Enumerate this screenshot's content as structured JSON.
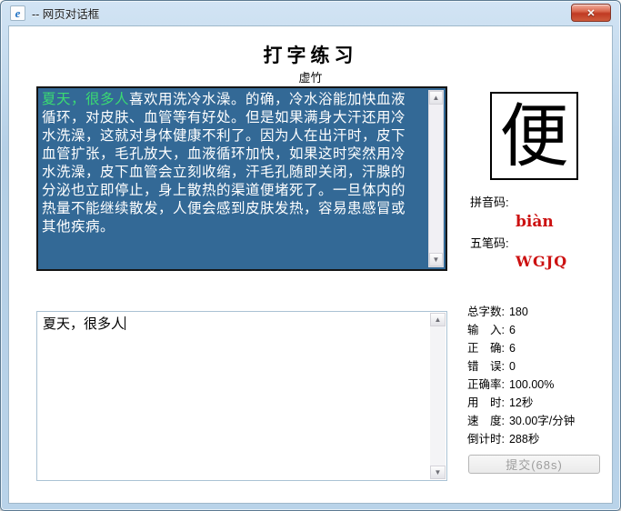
{
  "icons": {
    "ie_logo": "e",
    "close": "✕",
    "scroll_up": "▲",
    "scroll_down": "▼"
  },
  "window": {
    "title": "-- 网页对话框"
  },
  "header": {
    "title": "打字练习",
    "subtitle": "虚竹"
  },
  "passage": {
    "background_color": "#336996",
    "typed_color": "#3bdb72",
    "typed_text": "夏天，很多人",
    "lines": [
      "喜欢用洗冷水澡。的确，冷水浴能加快血液",
      "循环，对皮肤、血管等有好处。但是如果满身大汗还用冷",
      "水洗澡，这就对身体健康不利了。因为人在出汗时，皮下",
      "血管扩张，毛孔放大，血液循环加快，如果这时突然用冷",
      "水洗澡，皮下血管会立刻收缩，汗毛孔随即关闭，汗腺的",
      "分泌也立即停止，身上散热的渠道便堵死了。一旦体内的",
      "热量不能继续散发，人便会感到皮肤发热，容易患感冒或",
      "其他疾病。"
    ]
  },
  "input": {
    "value": "夏天，很多人"
  },
  "char_panel": {
    "current_char": "便",
    "pinyin_label": "拼音码:",
    "pinyin_value": "biàn",
    "wubi_label": "五笔码:",
    "wubi_value": "WGJQ",
    "code_color": "#cc1111"
  },
  "stats": [
    {
      "label": "总字数:",
      "value": "180"
    },
    {
      "label": "输　入:",
      "value": "6"
    },
    {
      "label": "正　确:",
      "value": "6"
    },
    {
      "label": "错　误:",
      "value": "0"
    },
    {
      "label": "正确率:",
      "value": "100.00%"
    },
    {
      "label": "用　时:",
      "value": "12秒"
    },
    {
      "label": "速　度:",
      "value": "30.00字/分钟"
    },
    {
      "label": "倒计时:",
      "value": "288秒"
    }
  ],
  "submit": {
    "label": "提交(68s)",
    "disabled": true
  }
}
